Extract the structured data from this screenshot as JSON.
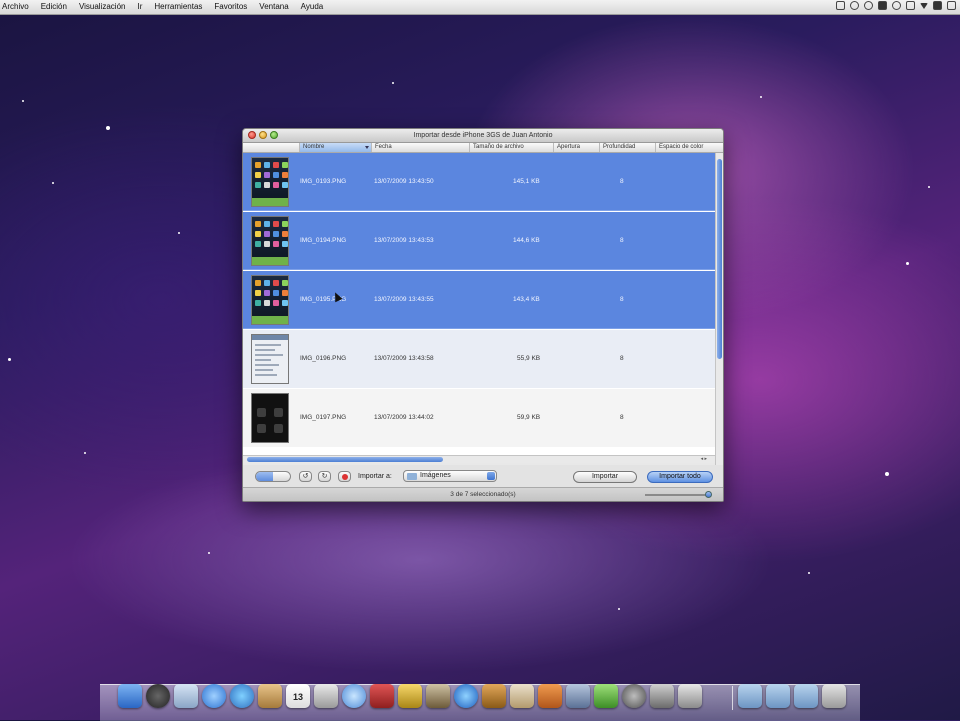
{
  "menubar": {
    "items": [
      "Archivo",
      "Edición",
      "Visualización",
      "Ir",
      "Herramientas",
      "Favoritos",
      "Ventana",
      "Ayuda"
    ]
  },
  "window": {
    "title": "Importar desde iPhone 3GS de Juan Antonio",
    "columns": [
      "Nombre",
      "Fecha",
      "Tamaño de archivo",
      "Apertura",
      "Profundidad",
      "Espacio de color"
    ],
    "rows": [
      {
        "name": "IMG_0193.PNG",
        "date": "13/07/2009 13:43:50",
        "size": "145,1 KB",
        "depth": "8",
        "selected": true,
        "thumb": "home"
      },
      {
        "name": "IMG_0194.PNG",
        "date": "13/07/2009 13:43:53",
        "size": "144,6 KB",
        "depth": "8",
        "selected": true,
        "thumb": "home"
      },
      {
        "name": "IMG_0195.PNG",
        "date": "13/07/2009 13:43:55",
        "size": "143,4 KB",
        "depth": "8",
        "selected": true,
        "thumb": "home"
      },
      {
        "name": "IMG_0196.PNG",
        "date": "13/07/2009 13:43:58",
        "size": "55,9 KB",
        "depth": "8",
        "selected": false,
        "thumb": "settings"
      },
      {
        "name": "IMG_0197.PNG",
        "date": "13/07/2009 13:44:02",
        "size": "59,9 KB",
        "depth": "8",
        "selected": false,
        "thumb": "dark"
      }
    ],
    "toolbar": {
      "import_to_label": "Importar a:",
      "destination": "Imágenes",
      "import_button": "Importar",
      "import_all_button": "Importar todo"
    },
    "status": "3 de 7 seleccionado(s)"
  },
  "colors": {
    "selection": "#5b86df",
    "accent_button": "#5f91e2"
  },
  "dock": {
    "calendar_date": "13"
  }
}
